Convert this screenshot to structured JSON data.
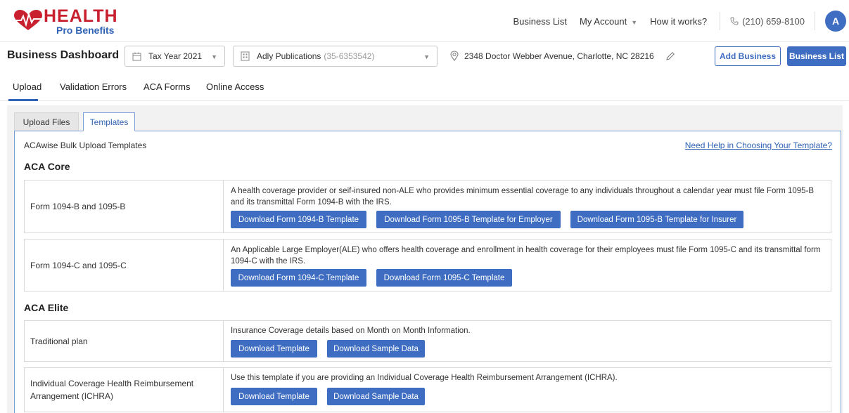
{
  "brand": {
    "name_line1": "HEALTH",
    "name_line2": "Pro Benefits",
    "heart_color": "#c8202f",
    "accent_color": "#2f63b5"
  },
  "topnav": {
    "business_list": "Business List",
    "my_account": "My Account",
    "how_it_works": "How it works?",
    "phone": "(210) 659-8100",
    "avatar_initial": "A"
  },
  "dashboard": {
    "title": "Business Dashboard",
    "tax_year": "Tax Year 2021",
    "business_name": "Adly Publications",
    "business_ein": "(35-6353542)",
    "address": "2348 Doctor Webber Avenue, Charlotte, NC 28216",
    "add_business": "Add Business",
    "business_list": "Business List"
  },
  "tabs": [
    {
      "label": "Upload",
      "active": true
    },
    {
      "label": "Validation Errors",
      "active": false
    },
    {
      "label": "ACA Forms",
      "active": false
    },
    {
      "label": "Online Access",
      "active": false
    }
  ],
  "subtabs": [
    {
      "label": "Upload Files",
      "active": false
    },
    {
      "label": "Templates",
      "active": true
    }
  ],
  "templates": {
    "heading": "ACAwise Bulk Upload Templates",
    "help_link": "Need Help in Choosing Your Template?",
    "sections": [
      {
        "title": "ACA Core",
        "rows": [
          {
            "label": "Form 1094-B and 1095-B",
            "description": "A health coverage provider or seif-insured non-ALE who provides minimum essential coverage to any individuals throughout a calendar year must file Form 1095-B and its transmittal Form 1094-B with the IRS.",
            "buttons": [
              "Download Form 1094-B Template",
              "Download Form 1095-B Template for Employer",
              "Download Form 1095-B Template for Insurer"
            ]
          },
          {
            "label": "Form 1094-C and 1095-C",
            "description": "An Applicable Large Employer(ALE) who offers health coverage and enrollment in health coverage for their employees must file Form 1095-C and its transmittal form 1094-C with the IRS.",
            "buttons": [
              "Download Form 1094-C Template",
              "Download Form 1095-C Template"
            ]
          }
        ]
      },
      {
        "title": "ACA Elite",
        "rows": [
          {
            "label": "Traditional plan",
            "description": "Insurance Coverage details based on Month on Month Information.",
            "buttons": [
              "Download Template",
              "Download Sample Data"
            ]
          },
          {
            "label": "Individual Coverage Health Reimbursement Arrangement (ICHRA)",
            "description": "Use this template if you are providing an Individual Coverage Health Reimbursement Arrangement (ICHRA).",
            "buttons": [
              "Download Template",
              "Download Sample Data"
            ]
          }
        ]
      }
    ]
  }
}
